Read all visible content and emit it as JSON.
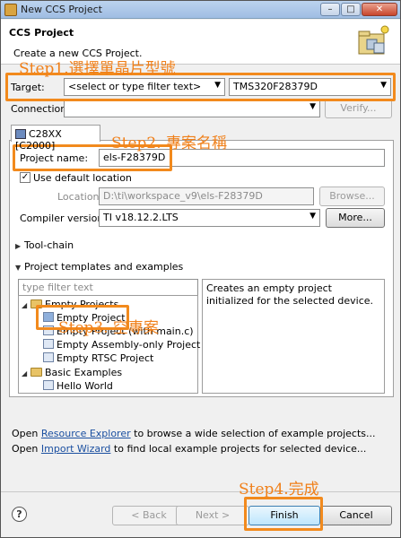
{
  "window": {
    "title": "New CCS Project"
  },
  "header": {
    "title": "CCS Project",
    "description": "Create a new CCS Project."
  },
  "target": {
    "label": "Target:",
    "filter_placeholder": "<select or type filter text>",
    "device": "TMS320F28379D"
  },
  "connection": {
    "label": "Connection:",
    "value": "",
    "verify_label": "Verify..."
  },
  "tab": {
    "label": "C28XX [C2000]"
  },
  "project": {
    "name_label": "Project name:",
    "name_value": "els-F28379D",
    "use_default_label": "Use default location",
    "use_default_checked": true,
    "location_label": "Location:",
    "location_value": "D:\\ti\\workspace_v9\\els-F28379D",
    "browse_label": "Browse...",
    "compiler_label": "Compiler version:",
    "compiler_value": "TI v18.12.2.LTS",
    "more_label": "More..."
  },
  "toolchain": {
    "label": "Tool-chain"
  },
  "templates": {
    "label": "Project templates and examples",
    "filter_placeholder": "type filter text",
    "tree": [
      {
        "label": "Empty Projects",
        "type": "folder"
      },
      {
        "label": "Empty Project",
        "type": "project",
        "selected": true
      },
      {
        "label": "Empty Project (with main.c)",
        "type": "project"
      },
      {
        "label": "Empty Assembly-only Project",
        "type": "project"
      },
      {
        "label": "Empty RTSC Project",
        "type": "project"
      },
      {
        "label": "Basic Examples",
        "type": "folder"
      },
      {
        "label": "Hello World",
        "type": "project"
      }
    ],
    "description": "Creates an empty project initialized for the selected device."
  },
  "footer": {
    "open1_prefix": "Open ",
    "open1_link": "Resource Explorer",
    "open1_suffix": " to browse a wide selection of example projects...",
    "open2_prefix": "Open ",
    "open2_link": "Import Wizard",
    "open2_suffix": " to find local example projects for selected device..."
  },
  "buttons": {
    "back": "< Back",
    "next": "Next >",
    "finish": "Finish",
    "cancel": "Cancel"
  },
  "annotations": {
    "step1": "Step1.選擇單晶片型號",
    "step2": "Step2. 專案名稱",
    "step3": "Step3. 空專案",
    "step4": "Step4.完成",
    "color": "#f28a1d"
  }
}
